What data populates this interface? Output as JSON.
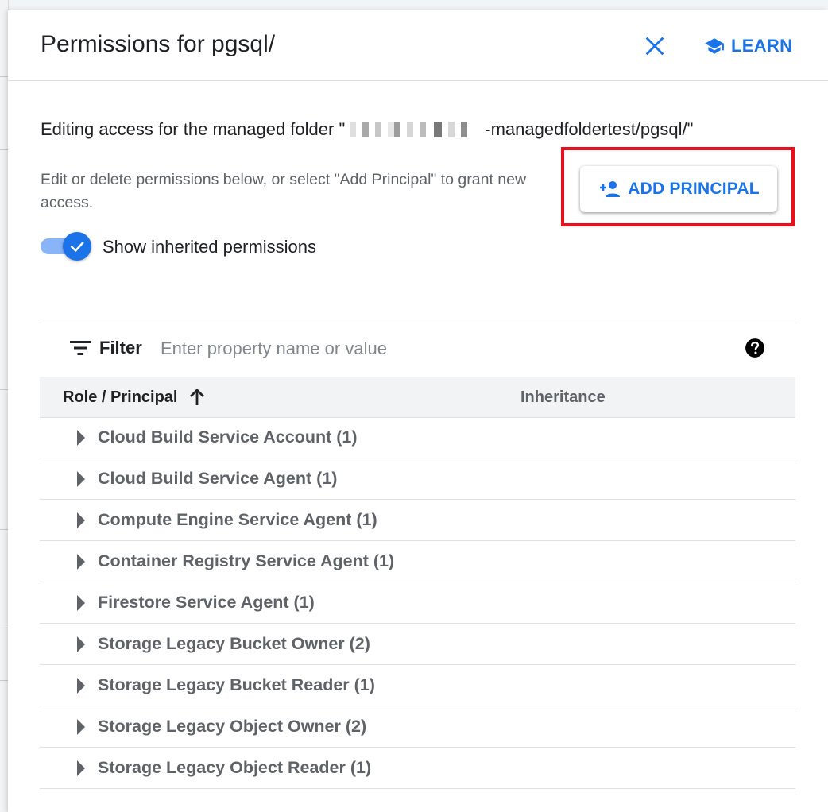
{
  "header": {
    "title": "Permissions for pgsql/",
    "learn_label": "LEARN"
  },
  "description": {
    "editing_prefix": "Editing access for the managed folder \"",
    "editing_suffix": "-managedfoldertest/pgsql/\"",
    "instructions": "Edit or delete permissions below, or select \"Add Principal\" to grant new access."
  },
  "add_principal_label": "ADD PRINCIPAL",
  "toggle": {
    "label": "Show inherited permissions",
    "checked": true
  },
  "filter": {
    "label": "Filter",
    "placeholder": "Enter property name or value"
  },
  "table": {
    "columns": [
      "Role / Principal",
      "Inheritance"
    ],
    "rows": [
      "Cloud Build Service Account (1)",
      "Cloud Build Service Agent (1)",
      "Compute Engine Service Agent (1)",
      "Container Registry Service Agent (1)",
      "Firestore Service Agent (1)",
      "Storage Legacy Bucket Owner (2)",
      "Storage Legacy Bucket Reader (1)",
      "Storage Legacy Object Owner (2)",
      "Storage Legacy Object Reader (1)"
    ]
  },
  "colors": {
    "accent": "#1a73e8",
    "highlight": "#e8101a",
    "muted_text": "#5f6368"
  },
  "icons": [
    "close-icon",
    "school-icon",
    "person-add-icon",
    "check-icon",
    "filter-icon",
    "help-icon",
    "arrow-up-icon",
    "caret-right-icon"
  ]
}
